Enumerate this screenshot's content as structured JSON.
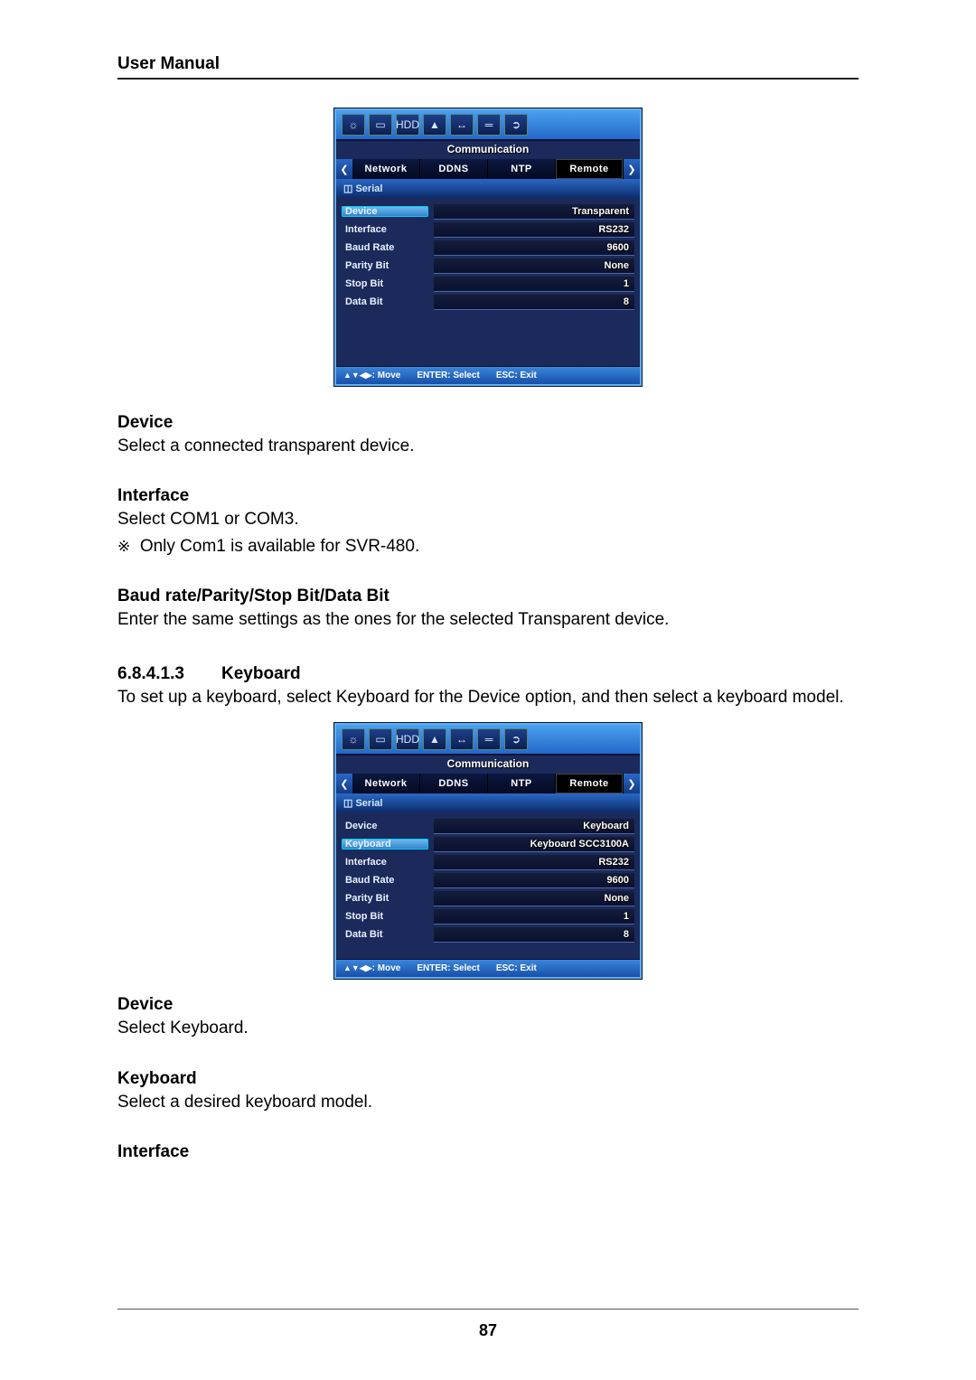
{
  "header_title": "User Manual",
  "page_number": "87",
  "screenshot1": {
    "toolbar_icons": [
      "gear-icon",
      "monitor-icon",
      "hdd-icon",
      "user-icon",
      "io-icon",
      "network-icon",
      "exit-icon"
    ],
    "title": "Communication",
    "tabs": [
      "Network",
      "DDNS",
      "NTP",
      "Remote"
    ],
    "section": "Serial",
    "highlight_row": 0,
    "rows": [
      {
        "label": "Device",
        "value": "Transparent"
      },
      {
        "label": "Interface",
        "value": "RS232"
      },
      {
        "label": "Baud Rate",
        "value": "9600"
      },
      {
        "label": "Parity Bit",
        "value": "None"
      },
      {
        "label": "Stop Bit",
        "value": "1"
      },
      {
        "label": "Data Bit",
        "value": "8"
      }
    ],
    "footer": {
      "move": ": Move",
      "enter": "ENTER: Select",
      "esc": "ESC: Exit"
    }
  },
  "doc_device_h": "Device",
  "doc_device_p": "Select a connected transparent device.",
  "doc_interface_h": "Interface",
  "doc_interface_p1": "Select COM1 or COM3.",
  "doc_interface_note_sym": "※",
  "doc_interface_note": "Only Com1 is available for SVR-480.",
  "doc_baud_h": "Baud rate/Parity/Stop Bit/Data Bit",
  "doc_baud_p": "Enter the same settings as the ones for the selected Transparent device.",
  "section_num": "6.8.4.1.3",
  "section_title": "Keyboard",
  "section_intro": "To set up a keyboard, select Keyboard for the Device option, and then select a keyboard model.",
  "screenshot2": {
    "toolbar_icons": [
      "gear-icon",
      "monitor-icon",
      "hdd-icon",
      "user-icon",
      "io-icon",
      "network-icon",
      "exit-icon"
    ],
    "title": "Communication",
    "tabs": [
      "Network",
      "DDNS",
      "NTP",
      "Remote"
    ],
    "section": "Serial",
    "highlight_row": 1,
    "rows": [
      {
        "label": "Device",
        "value": "Keyboard"
      },
      {
        "label": "Keyboard",
        "value": "Keyboard SCC3100A"
      },
      {
        "label": "Interface",
        "value": "RS232"
      },
      {
        "label": "Baud Rate",
        "value": "9600"
      },
      {
        "label": "Parity Bit",
        "value": "None"
      },
      {
        "label": "Stop Bit",
        "value": "1"
      },
      {
        "label": "Data Bit",
        "value": "8"
      }
    ],
    "footer": {
      "move": ": Move",
      "enter": "ENTER: Select",
      "esc": "ESC: Exit"
    }
  },
  "doc2_device_h": "Device",
  "doc2_device_p": "Select Keyboard.",
  "doc2_keyboard_h": "Keyboard",
  "doc2_keyboard_p": "Select a desired keyboard model.",
  "doc2_interface_h": "Interface"
}
